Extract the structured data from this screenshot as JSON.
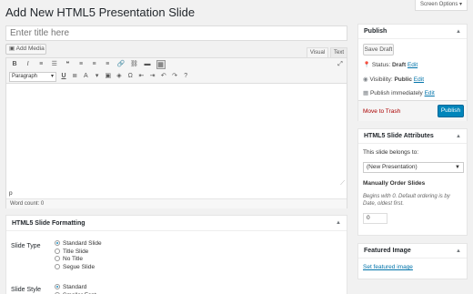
{
  "header": {
    "title": "Add New HTML5 Presentation Slide",
    "screen_options": "Screen Options"
  },
  "title_input": {
    "placeholder": "Enter title here"
  },
  "editor": {
    "add_media": "Add Media",
    "tab_visual": "Visual",
    "tab_text": "Text",
    "toolbar_row1": [
      {
        "glyph": "B",
        "name": "bold-icon"
      },
      {
        "glyph": "I",
        "name": "italic-icon"
      },
      {
        "glyph": "≡",
        "name": "bullet-list-icon"
      },
      {
        "glyph": "☰",
        "name": "numbered-list-icon"
      },
      {
        "glyph": "❝",
        "name": "blockquote-icon"
      },
      {
        "glyph": "≡",
        "name": "align-left-icon"
      },
      {
        "glyph": "≡",
        "name": "align-center-icon"
      },
      {
        "glyph": "≡",
        "name": "align-right-icon"
      },
      {
        "glyph": "🔗",
        "name": "insert-link-icon"
      },
      {
        "glyph": "⛓",
        "name": "remove-link-icon"
      },
      {
        "glyph": "▬",
        "name": "insert-more-icon"
      },
      {
        "glyph": "▦",
        "name": "toolbar-toggle-icon"
      }
    ],
    "fullscreen": "⤢",
    "format_select": "Paragraph",
    "toolbar_row2": [
      {
        "glyph": "U",
        "name": "underline-icon"
      },
      {
        "glyph": "≣",
        "name": "justify-icon"
      },
      {
        "glyph": "A",
        "name": "text-color-icon"
      },
      {
        "glyph": "▾",
        "name": "text-color-dropdown-icon"
      },
      {
        "glyph": "▣",
        "name": "paste-as-text-icon"
      },
      {
        "glyph": "◈",
        "name": "clear-formatting-icon"
      },
      {
        "glyph": "Ω",
        "name": "special-character-icon"
      },
      {
        "glyph": "⇤",
        "name": "outdent-icon"
      },
      {
        "glyph": "⇥",
        "name": "indent-icon"
      },
      {
        "glyph": "↶",
        "name": "undo-icon"
      },
      {
        "glyph": "↷",
        "name": "redo-icon"
      },
      {
        "glyph": "?",
        "name": "help-icon"
      }
    ],
    "path": "p",
    "word_count": "Word count: 0"
  },
  "formatting": {
    "title": "HTML5 Slide Formatting",
    "type_label": "Slide Type",
    "types": [
      "Standard Slide",
      "Title Slide",
      "No Title",
      "Segue Slide"
    ],
    "style_label": "Slide Style",
    "styles": [
      "Standard",
      "Smaller Font"
    ]
  },
  "publish": {
    "title": "Publish",
    "save_draft": "Save Draft",
    "status_label": "Status:",
    "status_value": "Draft",
    "visibility_label": "Visibility:",
    "visibility_value": "Public",
    "schedule_text": "Publish immediately",
    "edit": "Edit",
    "trash": "Move to Trash",
    "publish_btn": "Publish"
  },
  "attributes": {
    "title": "HTML5 Slide Attributes",
    "belongs_label": "This slide belongs to:",
    "belongs_value": "(New Presentation)",
    "order_label": "Manually Order Slides",
    "order_help": "Begins with 0. Default ordering is by Date, oldest first.",
    "order_value": "0"
  },
  "featured": {
    "title": "Featured Image",
    "link": "Set featured image"
  },
  "colors": {
    "primary": "#0085ba",
    "link": "#0073aa",
    "trash": "#a00"
  }
}
